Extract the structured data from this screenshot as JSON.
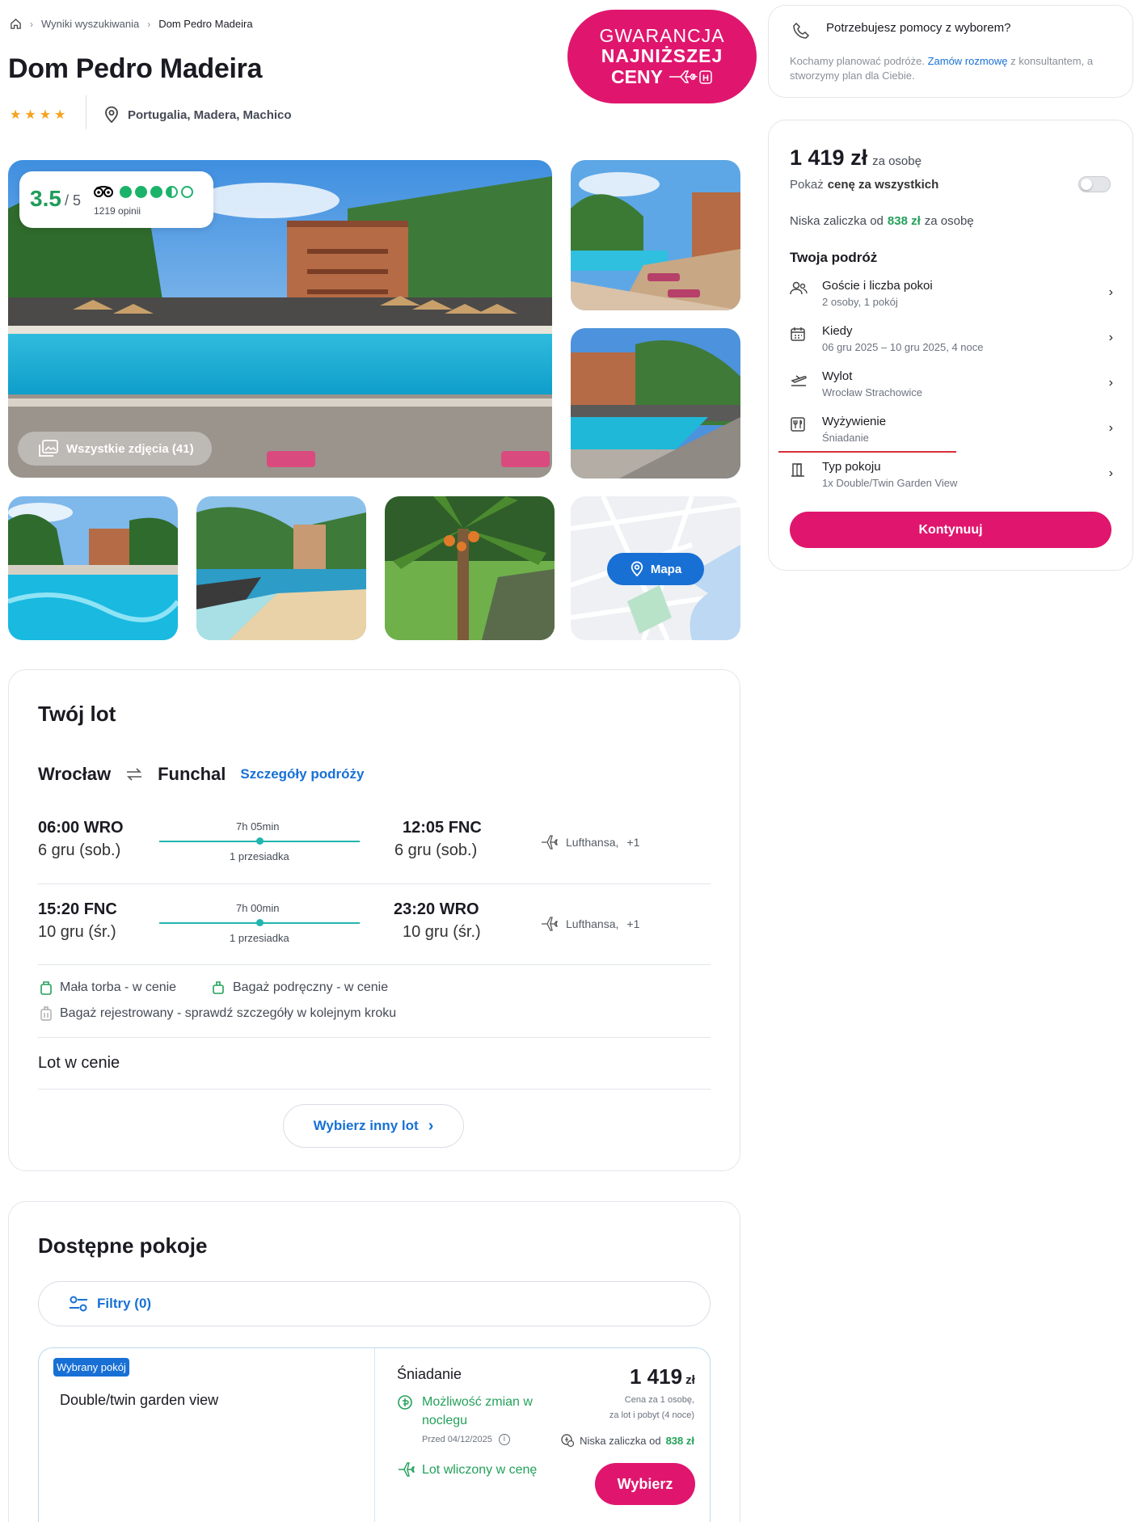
{
  "breadcrumb": {
    "results": "Wyniki wyszukiwania",
    "current": "Dom Pedro Madeira"
  },
  "hotel": {
    "name": "Dom Pedro Madeira",
    "stars": 4,
    "location": "Portugalia, Madera, Machico"
  },
  "guarantee": {
    "line1": "GWARANCJA",
    "line2": "NAJNIŻSZEJ",
    "line3": "CENY"
  },
  "rating": {
    "score": "3.5",
    "out_of": "/ 5",
    "reviews": "1219 opinii",
    "bubbles": 3.5
  },
  "gallery": {
    "all_photos": "Wszystkie zdjęcia (41)",
    "map_label": "Mapa"
  },
  "flight": {
    "heading": "Twój lot",
    "from": "Wrocław",
    "to": "Funchal",
    "details_link": "Szczegóły podróży",
    "legs": [
      {
        "dep_time": "06:00 WRO",
        "dep_date": "6 gru (sob.)",
        "duration": "7h 05min",
        "stops": "1 przesiadka",
        "arr_time": "12:05 FNC",
        "arr_date": "6 gru (sob.)",
        "airline": "Lufthansa,",
        "extra": "+1"
      },
      {
        "dep_time": "15:20 FNC",
        "dep_date": "10 gru (śr.)",
        "duration": "7h 00min",
        "stops": "1 przesiadka",
        "arr_time": "23:20 WRO",
        "arr_date": "10 gru (śr.)",
        "airline": "Lufthansa,",
        "extra": "+1"
      }
    ],
    "baggage": {
      "small": "Mała torba - w cenie",
      "cabin": "Bagaż podręczny - w cenie",
      "checked": "Bagaż rejestrowany - sprawdź szczegóły w kolejnym kroku"
    },
    "included": "Lot w cenie",
    "choose_other": "Wybierz inny lot"
  },
  "rooms": {
    "heading": "Dostępne pokoje",
    "filters": "Filtry (0)",
    "selected_badge": "Wybrany pokój",
    "room_name": "Double/twin garden view",
    "board": "Śniadanie",
    "change_line1": "Możliwość zmian w",
    "change_line2": "noclegu",
    "change_before": "Przed 04/12/2025",
    "flight_included": "Lot wliczony w cenę",
    "price": "1 419",
    "currency": "zł",
    "price_note1": "Cena za 1 osobę,",
    "price_note2": "za lot i pobyt (4 noce)",
    "deposit_text": "Niska zaliczka od",
    "deposit_value": "838 zł",
    "select_button": "Wybierz"
  },
  "help": {
    "title": "Potrzebujesz pomocy z wyborem?",
    "text_before": "Kochamy planować podróże.",
    "link": "Zamów rozmowę",
    "text_after": "z konsultantem, a",
    "text_line2": "stworzymy plan dla Ciebie."
  },
  "booking": {
    "price": "1 419 zł",
    "per_person": "za osobę",
    "show_total_prefix": "Pokaż",
    "show_total_bold": "cenę za wszystkich",
    "deposit_prefix": "Niska zaliczka od",
    "deposit_value": "838 zł",
    "deposit_suffix": "za osobę",
    "trip_heading": "Twoja podróż",
    "rows": [
      {
        "label": "Goście i liczba pokoi",
        "value": "2 osoby, 1 pokój",
        "icon": "guests-icon"
      },
      {
        "label": "Kiedy",
        "value": "06 gru 2025 – 10 gru 2025, 4 noce",
        "icon": "calendar-icon"
      },
      {
        "label": "Wylot",
        "value": "Wrocław Strachowice",
        "icon": "departure-icon"
      },
      {
        "label": "Wyżywienie",
        "value": "Śniadanie",
        "icon": "meal-icon"
      },
      {
        "label": "Typ pokoju",
        "value": "1x Double/Twin Garden View",
        "icon": "door-icon"
      }
    ],
    "continue": "Kontynuuj"
  },
  "colors": {
    "accent": "#e0166e",
    "link": "#1870d5",
    "green": "#23a15a",
    "teal": "#21b5ae"
  }
}
